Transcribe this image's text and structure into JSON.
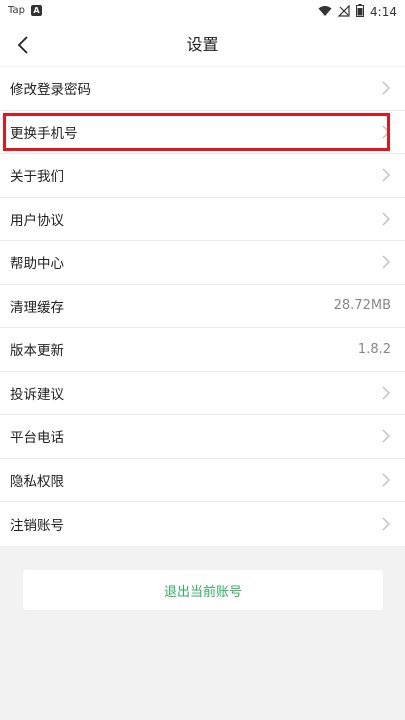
{
  "status_bar": {
    "left_text": "Tap",
    "app_badge": "A",
    "time": "4:14",
    "icons": [
      "wifi-icon",
      "no-signal-icon",
      "battery-icon"
    ]
  },
  "header": {
    "title": "设置",
    "back_icon": "chevron-left-icon"
  },
  "settings": {
    "items": [
      {
        "label": "修改登录密码"
      },
      {
        "label": "更换手机号"
      },
      {
        "label": "关于我们"
      },
      {
        "label": "用户协议"
      },
      {
        "label": "帮助中心"
      },
      {
        "label": "清理缓存",
        "value": "28.72MB"
      },
      {
        "label": "版本更新",
        "value": "1.8.2"
      },
      {
        "label": "投诉建议"
      },
      {
        "label": "平台电话"
      },
      {
        "label": "隐私权限"
      },
      {
        "label": "注销账号"
      }
    ],
    "highlighted_item": "更换手机号"
  },
  "logout": {
    "label": "退出当前账号"
  },
  "colors": {
    "accent_green": "#2fae5f",
    "highlight_red": "#e5151c",
    "page_bg": "#f2f2f2"
  }
}
